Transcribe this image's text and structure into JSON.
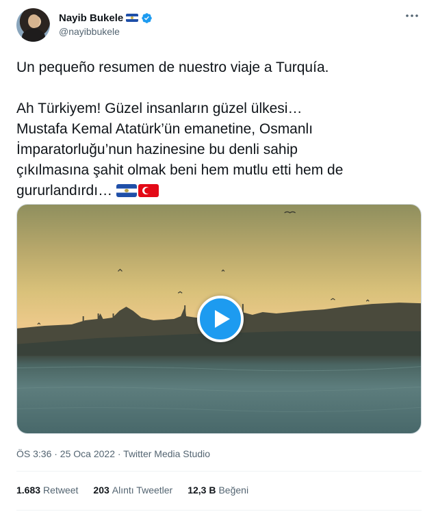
{
  "author": {
    "display_name": "Nayib Bukele",
    "handle": "@nayibbukele"
  },
  "icons": {
    "more": "more-horizontal-icon",
    "verified": "verified-badge-icon",
    "play": "play-icon"
  },
  "colors": {
    "accent": "#1d9bf0",
    "text": "#0f1419",
    "secondary_text": "#536471"
  },
  "tweet": {
    "line1": "Un pequeño resumen de nuestro viaje a Turquía.",
    "line2": "Ah Türkiyem! Güzel insanların güzel ülkesi…",
    "line3": "Mustafa Kemal Atatürk’ün emanetine, Osmanlı",
    "line4": "İmparatorluğu’nun hazinesine bu denli sahip",
    "line5": "çıkılmasına şahit olmak beni hem mutlu etti hem de",
    "line6": "gururlandırdı…",
    "emoji": [
      "flag-el-salvador",
      "flag-turkey"
    ]
  },
  "meta": {
    "timestamp": "ÖS 3:36 · 25 Oca 2022 · Twitter Media Studio"
  },
  "stats": {
    "retweets_value": "1.683",
    "retweets_label": "Retweet",
    "quotes_value": "203",
    "quotes_label": "Alıntı Tweetler",
    "likes_value": "12,3 B",
    "likes_label": "Beğeni"
  }
}
